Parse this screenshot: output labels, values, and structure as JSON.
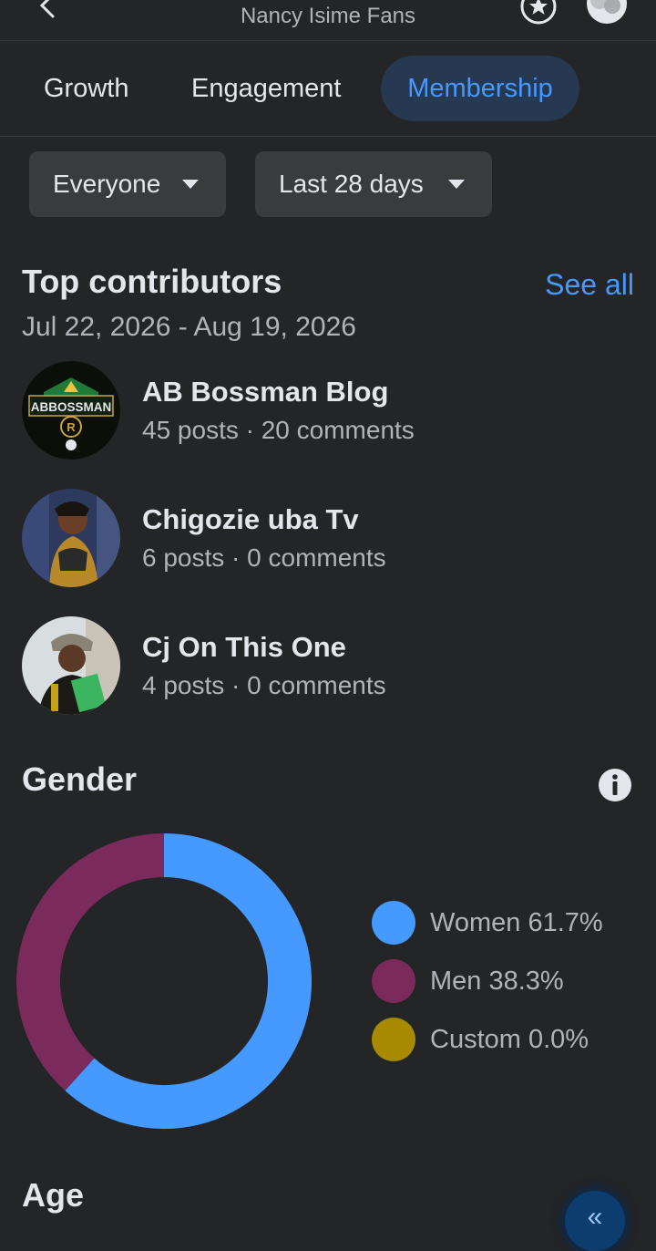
{
  "header": {
    "group_name": "Nancy Isime Fans",
    "back_icon": "chevron-left-icon",
    "star_icon": "star-circle-icon"
  },
  "tabs": [
    {
      "label": "Growth",
      "active": false
    },
    {
      "label": "Engagement",
      "active": false
    },
    {
      "label": "Membership",
      "active": true
    }
  ],
  "filters": {
    "audience": {
      "selected": "Everyone"
    },
    "period": {
      "selected": "Last 28 days"
    }
  },
  "top_contributors": {
    "title": "Top contributors",
    "see_all": "See all",
    "date_range": "Jul 22, 2026 - Aug 19, 2026",
    "items": [
      {
        "name": "AB Bossman Blog",
        "stats": "45 posts · 20 comments",
        "avatar_text": "ABBOSSMAN"
      },
      {
        "name": "Chigozie uba Tv",
        "stats": "6 posts · 0 comments"
      },
      {
        "name": "Cj On This One",
        "stats": "4 posts · 0 comments"
      }
    ]
  },
  "gender": {
    "title": "Gender",
    "info_icon": "info-icon"
  },
  "chart_data": {
    "type": "pie",
    "categories": [
      "Women",
      "Men",
      "Custom"
    ],
    "values": [
      61.7,
      38.3,
      0.0
    ],
    "legend": [
      "Women 61.7%",
      "Men 38.3%",
      "Custom 0.0%"
    ],
    "colors": [
      "#4599ff",
      "#7b2a5c",
      "#a88a00"
    ]
  },
  "age": {
    "title": "Age"
  },
  "fab": {
    "icon": "double-chevron-left-icon",
    "glyph": "«"
  },
  "colors": {
    "accent": "#4599ff",
    "background": "#242527",
    "tab_active_bg": "#263951"
  }
}
